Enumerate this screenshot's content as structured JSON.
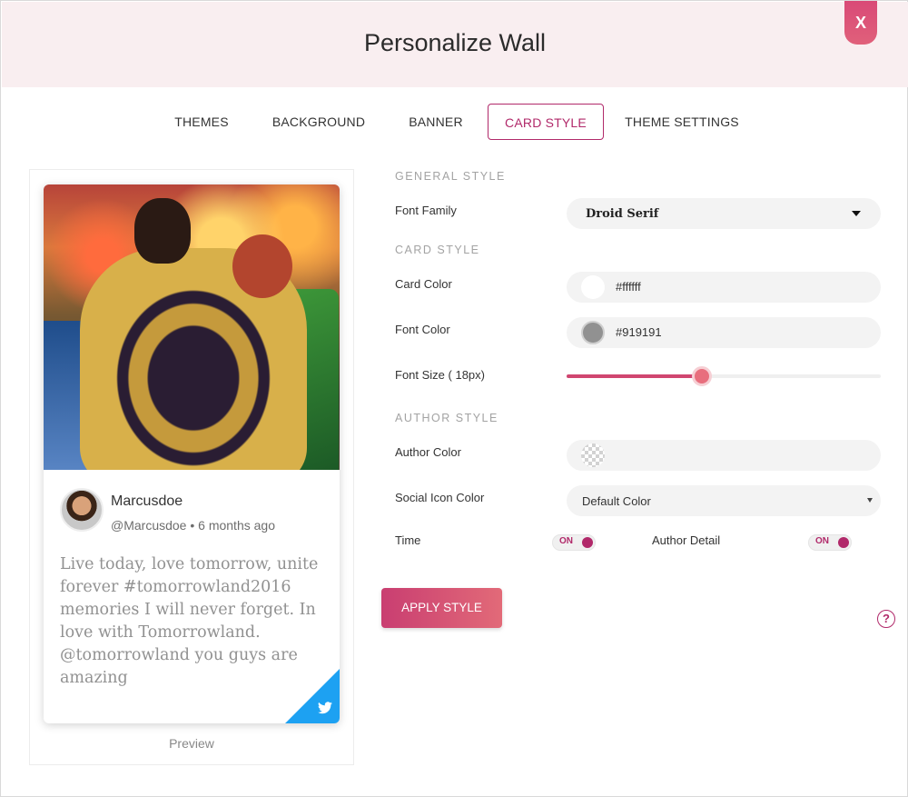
{
  "header": {
    "title": "Personalize Wall",
    "close_label": "X"
  },
  "tabs": [
    {
      "label": "THEMES"
    },
    {
      "label": "BACKGROUND"
    },
    {
      "label": "BANNER"
    },
    {
      "label": "CARD STYLE",
      "active": true
    },
    {
      "label": "THEME SETTINGS"
    }
  ],
  "preview": {
    "author_name": "Marcusdoe",
    "author_meta": "@Marcusdoe • 6 months ago",
    "text": "Live today, love tomorrow, unite forever #tomorrowland2016 memories I will never forget. In love with Tomorrowland. @tomorrowland you guys are amazing",
    "social_icon": "twitter-icon",
    "label": "Preview"
  },
  "general_style": {
    "heading": "GENERAL STYLE",
    "font_family_label": "Font Family",
    "font_family_value": "Droid Serif"
  },
  "card_style": {
    "heading": "CARD STYLE",
    "card_color_label": "Card Color",
    "card_color_value": "#ffffff",
    "font_color_label": "Font Color",
    "font_color_value": "#919191",
    "font_size_label": "Font Size ( 18px)",
    "font_size_fraction": 0.43
  },
  "author_style": {
    "heading": "AUTHOR STYLE",
    "author_color_label": "Author Color",
    "social_icon_color_label": "Social Icon Color",
    "social_icon_color_value": "Default Color",
    "time_label": "Time",
    "time_toggle": "ON",
    "author_detail_label": "Author Detail",
    "author_detail_toggle": "ON"
  },
  "actions": {
    "apply_label": "APPLY STYLE",
    "help_label": "?"
  },
  "colors": {
    "accent": "#b1296a",
    "header_bg": "#f9eef0",
    "twitter": "#1da1f2"
  }
}
